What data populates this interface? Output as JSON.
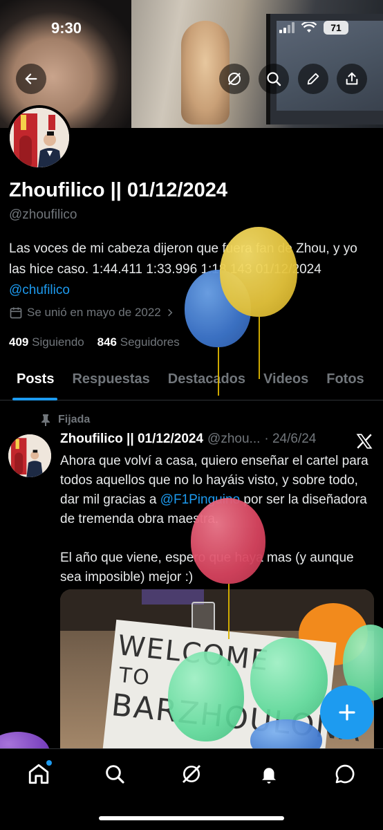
{
  "status_bar": {
    "time": "9:30",
    "battery": "71"
  },
  "profile": {
    "name": "Zhoufilico || 01/12/2024",
    "handle": "@zhoufilico",
    "bio_text": "Las voces de mi cabeza dijeron que fuera fan de Zhou, y yo las hice caso. 1:44.411 1:33.996 1:18.143 01/12/2024",
    "bio_link": "@chufilico",
    "joined": "Se unió en mayo de 2022",
    "following_count": "409",
    "following_label": "Siguiendo",
    "followers_count": "846",
    "followers_label": "Seguidores"
  },
  "tabs": [
    {
      "label": "Posts"
    },
    {
      "label": "Respuestas"
    },
    {
      "label": "Destacados"
    },
    {
      "label": "Videos"
    },
    {
      "label": "Fotos"
    }
  ],
  "pinned_tweet": {
    "pinned_label": "Fijada",
    "author": "Zhoufilico || 01/12/2024",
    "handle_trunc": "@zhou...",
    "date": "· 24/6/24",
    "text_1": "Ahora que volví a casa, quiero enseñar el cartel para todos aquellos que no lo hayáis visto, y sobre todo, dar mil gracias a ",
    "mention": "@F1Pinguino",
    "text_2": " por ser la diseñadora de tremenda obra maestra.",
    "text_3": "El año que viene, espero que haya mas (y aunque sea imposible) mejor :)",
    "poster_line1": "WELCOME",
    "poster_line2": "TO",
    "poster_line3": "BARZHOULONA"
  },
  "icons": {
    "back": "arrow-left-icon",
    "grok": "grok-icon",
    "search": "search-icon",
    "edit": "pencil-icon",
    "share": "share-icon",
    "calendar": "calendar-icon",
    "pin": "pin-icon",
    "x": "x-logo-icon",
    "compose": "plus-icon"
  },
  "colors": {
    "accent": "#1d9bf0",
    "background": "#000000",
    "muted": "#71767b"
  }
}
